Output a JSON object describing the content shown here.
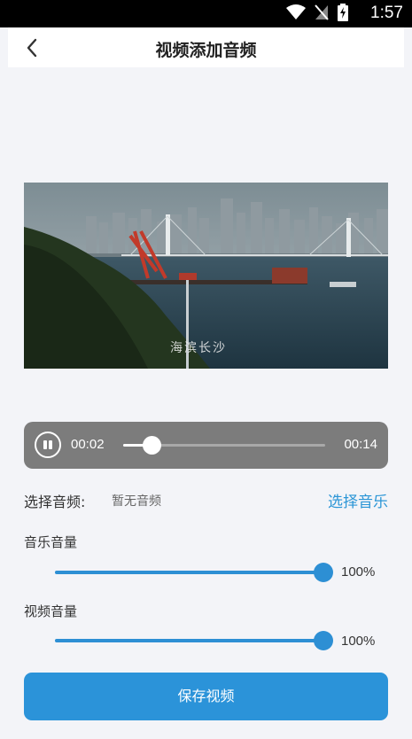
{
  "status_bar": {
    "time": "1:57",
    "icons": [
      "wifi-icon",
      "no-sim-icon",
      "battery-charging-icon"
    ]
  },
  "header": {
    "title": "视频添加音频",
    "back_icon": "chevron-left-icon"
  },
  "video": {
    "watermark": "海滨长沙"
  },
  "player": {
    "current_time": "00:02",
    "total_time": "00:14",
    "progress": 0.14,
    "pause_icon": "pause-icon"
  },
  "audio": {
    "label": "选择音频:",
    "value": "暂无音频",
    "choose_label": "选择音乐"
  },
  "music_volume": {
    "label": "音乐音量",
    "percent_text": "100%",
    "level": 1.0
  },
  "video_volume": {
    "label": "视频音量",
    "percent_text": "100%",
    "level": 1.0
  },
  "save_button": {
    "label": "保存视频"
  },
  "colors": {
    "accent": "#2b93d9",
    "player_bg": "#7c7c7c",
    "page_bg": "#f3f4f8"
  }
}
